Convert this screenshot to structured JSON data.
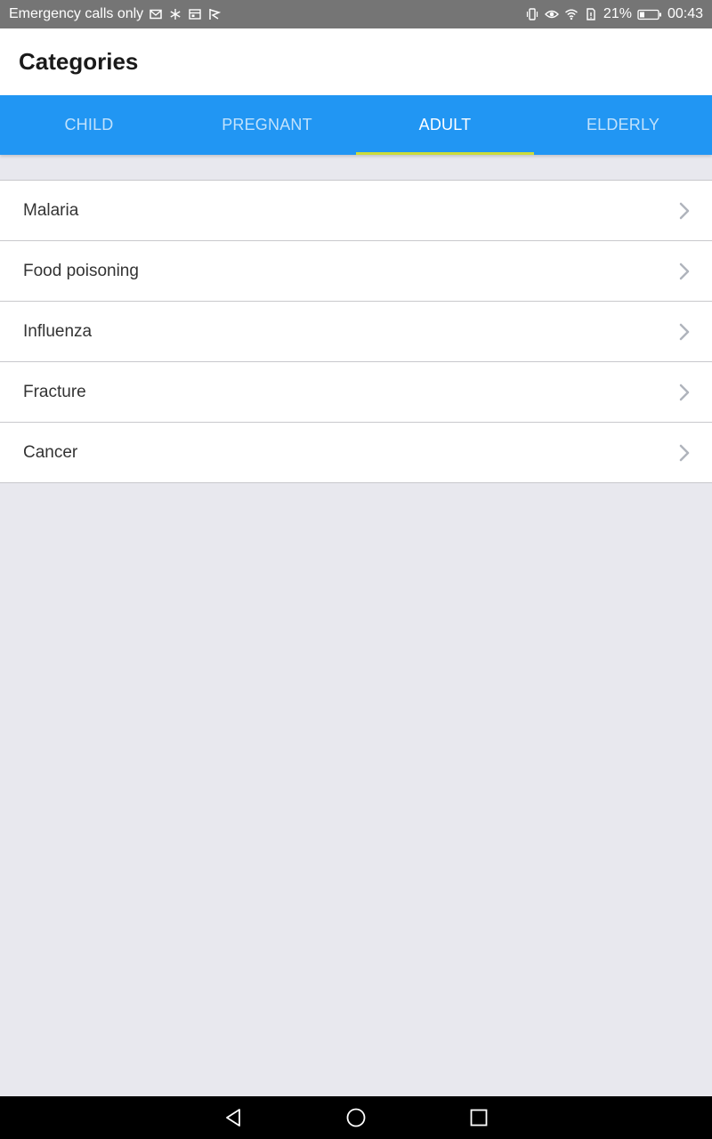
{
  "status_bar": {
    "carrier_text": "Emergency calls only",
    "battery_percent": "21%",
    "time": "00:43",
    "left_icons": [
      "mail-icon",
      "snowflake-icon",
      "calendar-icon",
      "flag-icon"
    ],
    "right_icons": [
      "vibrate-icon",
      "eye-icon",
      "wifi-icon",
      "sim-icon",
      "battery-icon"
    ]
  },
  "app_bar": {
    "title": "Categories"
  },
  "tabs": [
    {
      "label": "CHILD",
      "active": false
    },
    {
      "label": "PREGNANT",
      "active": false
    },
    {
      "label": "ADULT",
      "active": true
    },
    {
      "label": "ELDERLY",
      "active": false
    }
  ],
  "list": {
    "items": [
      {
        "label": "Malaria",
        "icon": "chevron-right-icon"
      },
      {
        "label": "Food poisoning",
        "icon": "chevron-right-icon"
      },
      {
        "label": "Influenza",
        "icon": "chevron-right-icon"
      },
      {
        "label": "Fracture",
        "icon": "chevron-right-icon"
      },
      {
        "label": "Cancer",
        "icon": "chevron-right-icon"
      }
    ]
  },
  "nav_bar": {
    "buttons": [
      "back-icon",
      "home-icon",
      "recents-icon"
    ]
  },
  "colors": {
    "tab_bar": "#2196f3",
    "tab_indicator": "#cddc39",
    "status_bar": "#757575",
    "background": "#e8e8ee",
    "chevron": "#b0b4bc"
  }
}
